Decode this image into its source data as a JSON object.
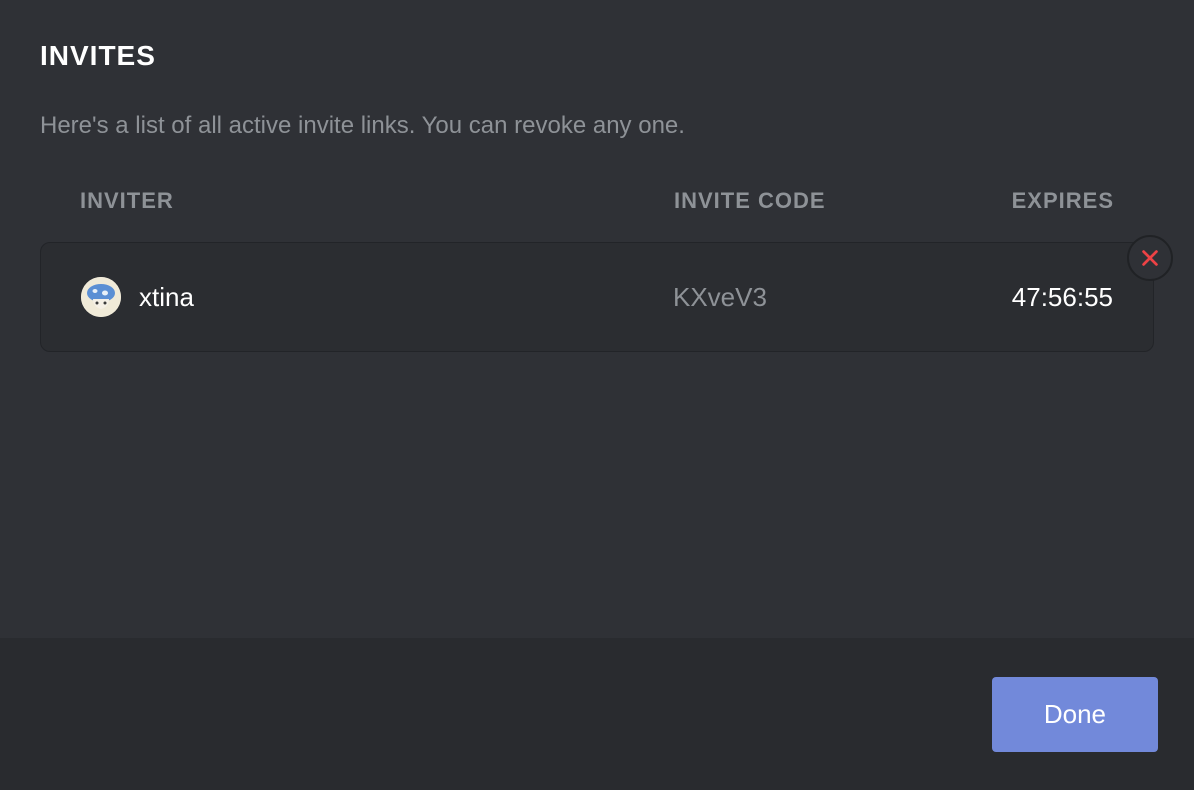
{
  "page": {
    "title": "INVITES",
    "description": "Here's a list of all active invite links. You can revoke any one."
  },
  "columns": {
    "inviter": "INVITER",
    "invite_code": "INVITE CODE",
    "expires": "EXPIRES"
  },
  "invites": [
    {
      "inviter_name": "xtina",
      "invite_code": "KXveV3",
      "expires": "47:56:55"
    }
  ],
  "footer": {
    "done_label": "Done"
  }
}
